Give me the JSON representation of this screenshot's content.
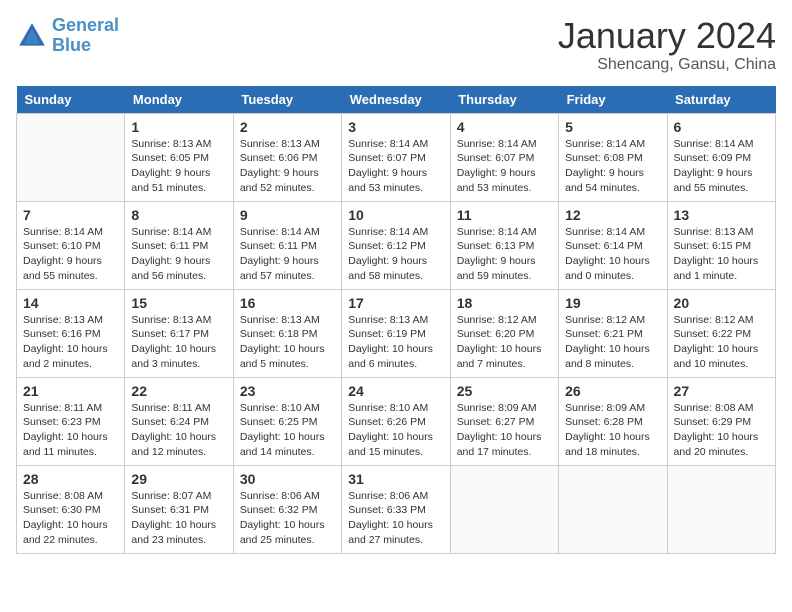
{
  "header": {
    "logo_line1": "General",
    "logo_line2": "Blue",
    "month": "January 2024",
    "location": "Shencang, Gansu, China"
  },
  "weekdays": [
    "Sunday",
    "Monday",
    "Tuesday",
    "Wednesday",
    "Thursday",
    "Friday",
    "Saturday"
  ],
  "weeks": [
    [
      {
        "day": "",
        "data": ""
      },
      {
        "day": "1",
        "data": "Sunrise: 8:13 AM\nSunset: 6:05 PM\nDaylight: 9 hours\nand 51 minutes."
      },
      {
        "day": "2",
        "data": "Sunrise: 8:13 AM\nSunset: 6:06 PM\nDaylight: 9 hours\nand 52 minutes."
      },
      {
        "day": "3",
        "data": "Sunrise: 8:14 AM\nSunset: 6:07 PM\nDaylight: 9 hours\nand 53 minutes."
      },
      {
        "day": "4",
        "data": "Sunrise: 8:14 AM\nSunset: 6:07 PM\nDaylight: 9 hours\nand 53 minutes."
      },
      {
        "day": "5",
        "data": "Sunrise: 8:14 AM\nSunset: 6:08 PM\nDaylight: 9 hours\nand 54 minutes."
      },
      {
        "day": "6",
        "data": "Sunrise: 8:14 AM\nSunset: 6:09 PM\nDaylight: 9 hours\nand 55 minutes."
      }
    ],
    [
      {
        "day": "7",
        "data": "Sunrise: 8:14 AM\nSunset: 6:10 PM\nDaylight: 9 hours\nand 55 minutes."
      },
      {
        "day": "8",
        "data": "Sunrise: 8:14 AM\nSunset: 6:11 PM\nDaylight: 9 hours\nand 56 minutes."
      },
      {
        "day": "9",
        "data": "Sunrise: 8:14 AM\nSunset: 6:11 PM\nDaylight: 9 hours\nand 57 minutes."
      },
      {
        "day": "10",
        "data": "Sunrise: 8:14 AM\nSunset: 6:12 PM\nDaylight: 9 hours\nand 58 minutes."
      },
      {
        "day": "11",
        "data": "Sunrise: 8:14 AM\nSunset: 6:13 PM\nDaylight: 9 hours\nand 59 minutes."
      },
      {
        "day": "12",
        "data": "Sunrise: 8:14 AM\nSunset: 6:14 PM\nDaylight: 10 hours\nand 0 minutes."
      },
      {
        "day": "13",
        "data": "Sunrise: 8:13 AM\nSunset: 6:15 PM\nDaylight: 10 hours\nand 1 minute."
      }
    ],
    [
      {
        "day": "14",
        "data": "Sunrise: 8:13 AM\nSunset: 6:16 PM\nDaylight: 10 hours\nand 2 minutes."
      },
      {
        "day": "15",
        "data": "Sunrise: 8:13 AM\nSunset: 6:17 PM\nDaylight: 10 hours\nand 3 minutes."
      },
      {
        "day": "16",
        "data": "Sunrise: 8:13 AM\nSunset: 6:18 PM\nDaylight: 10 hours\nand 5 minutes."
      },
      {
        "day": "17",
        "data": "Sunrise: 8:13 AM\nSunset: 6:19 PM\nDaylight: 10 hours\nand 6 minutes."
      },
      {
        "day": "18",
        "data": "Sunrise: 8:12 AM\nSunset: 6:20 PM\nDaylight: 10 hours\nand 7 minutes."
      },
      {
        "day": "19",
        "data": "Sunrise: 8:12 AM\nSunset: 6:21 PM\nDaylight: 10 hours\nand 8 minutes."
      },
      {
        "day": "20",
        "data": "Sunrise: 8:12 AM\nSunset: 6:22 PM\nDaylight: 10 hours\nand 10 minutes."
      }
    ],
    [
      {
        "day": "21",
        "data": "Sunrise: 8:11 AM\nSunset: 6:23 PM\nDaylight: 10 hours\nand 11 minutes."
      },
      {
        "day": "22",
        "data": "Sunrise: 8:11 AM\nSunset: 6:24 PM\nDaylight: 10 hours\nand 12 minutes."
      },
      {
        "day": "23",
        "data": "Sunrise: 8:10 AM\nSunset: 6:25 PM\nDaylight: 10 hours\nand 14 minutes."
      },
      {
        "day": "24",
        "data": "Sunrise: 8:10 AM\nSunset: 6:26 PM\nDaylight: 10 hours\nand 15 minutes."
      },
      {
        "day": "25",
        "data": "Sunrise: 8:09 AM\nSunset: 6:27 PM\nDaylight: 10 hours\nand 17 minutes."
      },
      {
        "day": "26",
        "data": "Sunrise: 8:09 AM\nSunset: 6:28 PM\nDaylight: 10 hours\nand 18 minutes."
      },
      {
        "day": "27",
        "data": "Sunrise: 8:08 AM\nSunset: 6:29 PM\nDaylight: 10 hours\nand 20 minutes."
      }
    ],
    [
      {
        "day": "28",
        "data": "Sunrise: 8:08 AM\nSunset: 6:30 PM\nDaylight: 10 hours\nand 22 minutes."
      },
      {
        "day": "29",
        "data": "Sunrise: 8:07 AM\nSunset: 6:31 PM\nDaylight: 10 hours\nand 23 minutes."
      },
      {
        "day": "30",
        "data": "Sunrise: 8:06 AM\nSunset: 6:32 PM\nDaylight: 10 hours\nand 25 minutes."
      },
      {
        "day": "31",
        "data": "Sunrise: 8:06 AM\nSunset: 6:33 PM\nDaylight: 10 hours\nand 27 minutes."
      },
      {
        "day": "",
        "data": ""
      },
      {
        "day": "",
        "data": ""
      },
      {
        "day": "",
        "data": ""
      }
    ]
  ]
}
